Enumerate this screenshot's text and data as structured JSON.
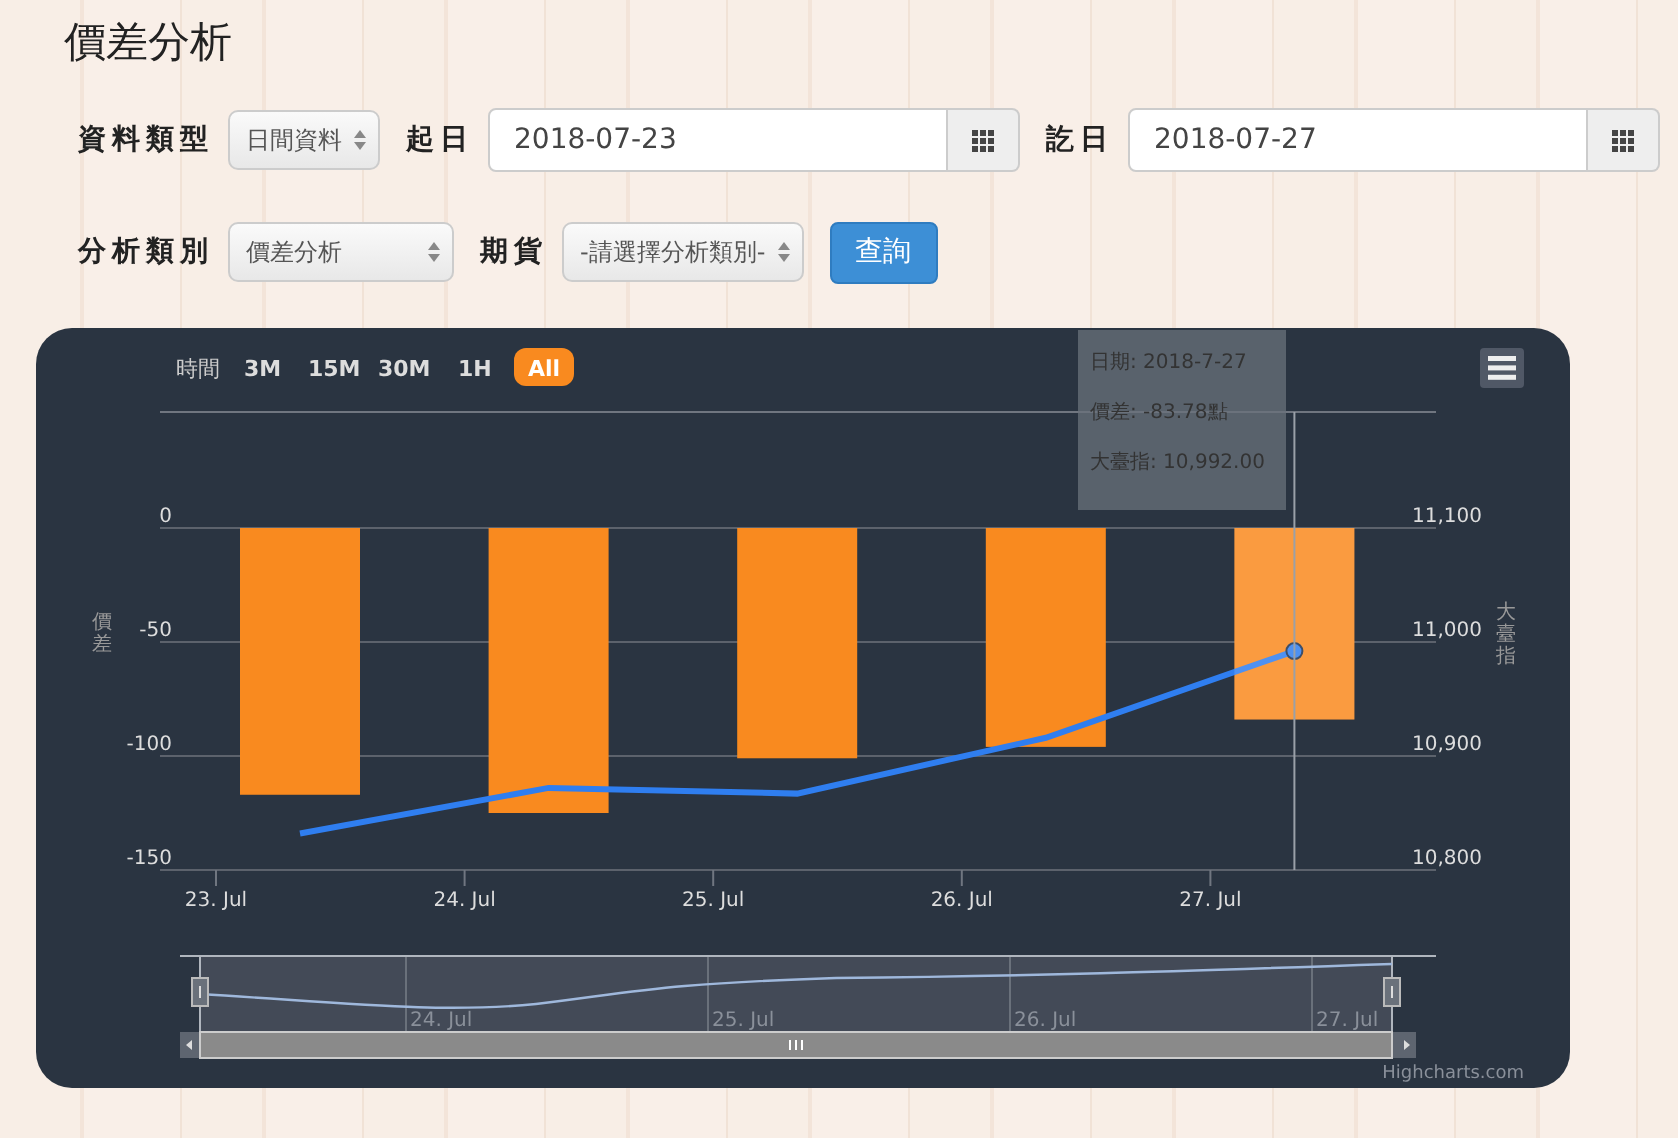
{
  "title": "價差分析",
  "form": {
    "row1": [
      {
        "kind": "label",
        "text": "資料類型"
      },
      {
        "kind": "select",
        "value": "日間資料"
      },
      {
        "kind": "label",
        "text": "起日"
      },
      {
        "kind": "date",
        "value": "2018-07-23"
      },
      {
        "kind": "label",
        "text": "訖日"
      },
      {
        "kind": "date",
        "value": "2018-07-27"
      }
    ],
    "row2": [
      {
        "kind": "label",
        "text": "分析類別"
      },
      {
        "kind": "select",
        "value": "價差分析"
      },
      {
        "kind": "label",
        "text": "期貨"
      },
      {
        "kind": "select",
        "value": "-請選擇分析類別-"
      },
      {
        "kind": "button",
        "text": "查詢"
      }
    ]
  },
  "chart": {
    "range_label": "時間",
    "range_buttons": [
      {
        "label": "3M",
        "selected": false
      },
      {
        "label": "15M",
        "selected": false
      },
      {
        "label": "30M",
        "selected": false
      },
      {
        "label": "1H",
        "selected": false
      },
      {
        "label": "All",
        "selected": true
      }
    ],
    "tooltip": [
      "日期: 2018-7-27",
      "價差: -83.78點",
      "大臺指: 10,992.00"
    ],
    "navigator_labels": [
      "24. Jul",
      "25. Jul",
      "26. Jul",
      "27. Jul"
    ],
    "credit": "Highcharts.com",
    "hover_states": [
      {
        "selected": false
      },
      {
        "selected": false
      },
      {
        "selected": false
      },
      {
        "selected": false
      },
      {
        "selected": true
      }
    ],
    "bars": {
      "chart_data": {
        "type": "bar",
        "categories": [
          "23. Jul",
          "24. Jul",
          "25. Jul",
          "26. Jul",
          "27. Jul"
        ],
        "ylim": [
          -150,
          0
        ],
        "yticks": [
          0,
          -50,
          -100,
          -150
        ],
        "series": [
          {
            "name": "價差",
            "color": "#f98a1f",
            "values": [
              -117,
              -125,
              -101,
              -96,
              -84
            ]
          }
        ]
      }
    },
    "line": {
      "chart_data": {
        "type": "line",
        "ylim": [
          10800,
          11100
        ],
        "yticks": [
          {
            "value": 11100,
            "label": "11,100"
          },
          {
            "value": 11000,
            "label": "11,000"
          },
          {
            "value": 10900,
            "label": "10,900"
          },
          {
            "value": 10800,
            "label": "10,800"
          }
        ],
        "series": [
          {
            "name": "大臺指",
            "color": "#2f7ef0",
            "values": [
              10832,
              10872,
              10867,
              10916,
              10992
            ]
          }
        ]
      }
    }
  }
}
